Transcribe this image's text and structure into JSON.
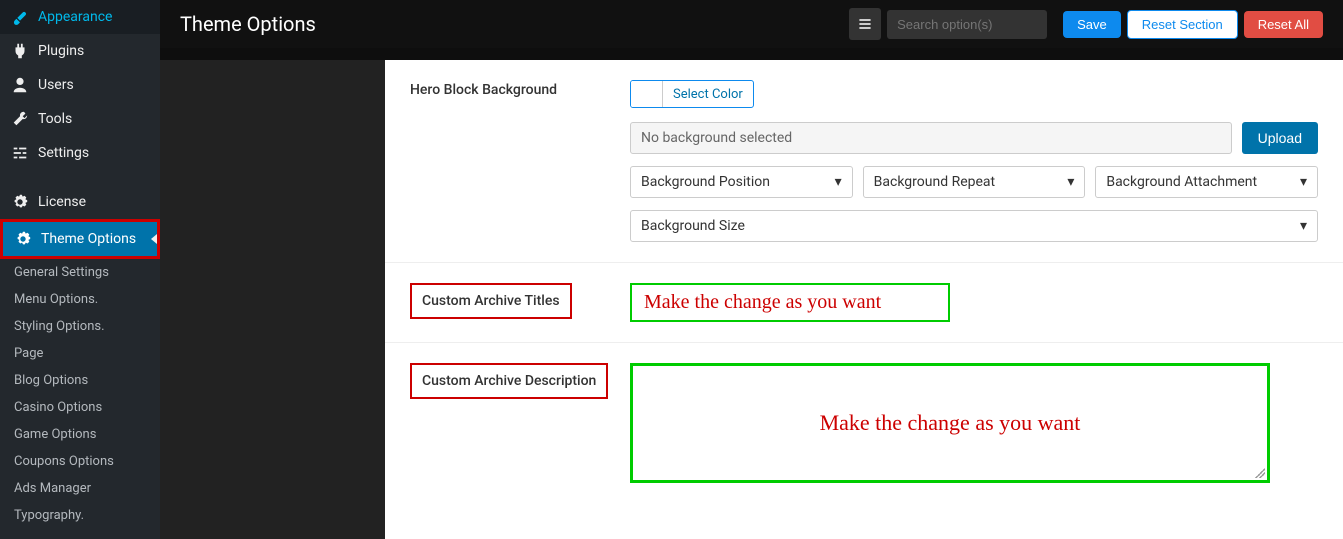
{
  "sidebar": {
    "items": [
      {
        "label": "Appearance",
        "icon": "brush"
      },
      {
        "label": "Plugins",
        "icon": "plug"
      },
      {
        "label": "Users",
        "icon": "user"
      },
      {
        "label": "Tools",
        "icon": "wrench"
      },
      {
        "label": "Settings",
        "icon": "sliders"
      },
      {
        "label": "License",
        "icon": "gear"
      },
      {
        "label": "Theme Options",
        "icon": "gear",
        "active": true
      }
    ],
    "subitems": [
      "General Settings",
      "Menu Options.",
      "Styling Options.",
      "Page",
      "Blog Options",
      "Casino Options",
      "Game Options",
      "Coupons Options",
      "Ads Manager",
      "Typography."
    ]
  },
  "topbar": {
    "title": "Theme Options",
    "search_placeholder": "Search option(s)",
    "save": "Save",
    "reset_section": "Reset Section",
    "reset_all": "Reset All"
  },
  "options": {
    "hero_bg_label": "Hero Block Background",
    "select_color": "Select Color",
    "no_bg_text": "No background selected",
    "upload": "Upload",
    "bg_position": "Background Position",
    "bg_repeat": "Background Repeat",
    "bg_attachment": "Background Attachment",
    "bg_size": "Background Size",
    "archive_titles_label": "Custom Archive Titles",
    "archive_titles_hint": "Make the change as you want",
    "archive_desc_label": "Custom Archive Description",
    "archive_desc_hint": "Make the change as you want"
  }
}
